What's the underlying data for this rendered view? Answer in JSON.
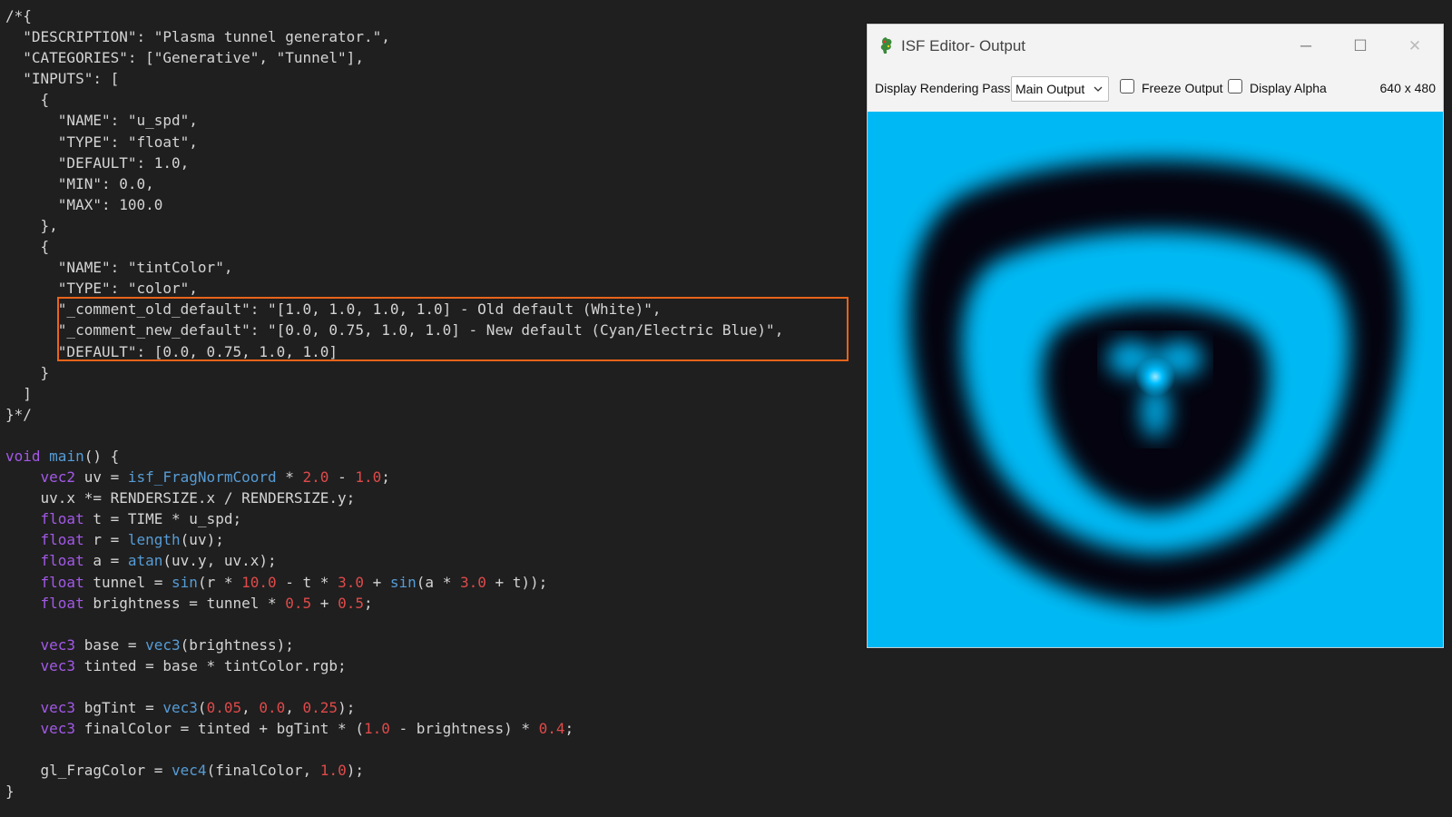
{
  "code_lines": [
    [
      {
        "t": "/*{",
        "c": ""
      }
    ],
    [
      {
        "t": "  \"DESCRIPTION\": \"Plasma tunnel generator.\",",
        "c": ""
      }
    ],
    [
      {
        "t": "  \"CATEGORIES\": [\"Generative\", \"Tunnel\"],",
        "c": ""
      }
    ],
    [
      {
        "t": "  \"INPUTS\": [",
        "c": ""
      }
    ],
    [
      {
        "t": "    {",
        "c": ""
      }
    ],
    [
      {
        "t": "      \"NAME\": \"u_spd\",",
        "c": ""
      }
    ],
    [
      {
        "t": "      \"TYPE\": \"float\",",
        "c": ""
      }
    ],
    [
      {
        "t": "      \"DEFAULT\": 1.0,",
        "c": ""
      }
    ],
    [
      {
        "t": "      \"MIN\": 0.0,",
        "c": ""
      }
    ],
    [
      {
        "t": "      \"MAX\": 100.0",
        "c": ""
      }
    ],
    [
      {
        "t": "    },",
        "c": ""
      }
    ],
    [
      {
        "t": "    {",
        "c": ""
      }
    ],
    [
      {
        "t": "      \"NAME\": \"tintColor\",",
        "c": ""
      }
    ],
    [
      {
        "t": "      \"TYPE\": \"color\",",
        "c": ""
      }
    ],
    [
      {
        "t": "      \"_comment_old_default\": \"[1.0, 1.0, 1.0, 1.0] - Old default (White)\",",
        "c": ""
      }
    ],
    [
      {
        "t": "      \"_comment_new_default\": \"[0.0, 0.75, 1.0, 1.0] - New default (Cyan/Electric Blue)\",",
        "c": ""
      }
    ],
    [
      {
        "t": "      \"DEFAULT\": [0.0, 0.75, 1.0, 1.0]",
        "c": ""
      }
    ],
    [
      {
        "t": "    }",
        "c": ""
      }
    ],
    [
      {
        "t": "  ]",
        "c": ""
      }
    ],
    [
      {
        "t": "}*/",
        "c": ""
      }
    ],
    [
      {
        "t": "",
        "c": ""
      }
    ],
    [
      {
        "t": "void",
        "c": "kw"
      },
      {
        "t": " ",
        "c": ""
      },
      {
        "t": "main",
        "c": "fn"
      },
      {
        "t": "() {",
        "c": ""
      }
    ],
    [
      {
        "t": "    ",
        "c": ""
      },
      {
        "t": "vec2",
        "c": "kw"
      },
      {
        "t": " uv = ",
        "c": ""
      },
      {
        "t": "isf_FragNormCoord",
        "c": "fn"
      },
      {
        "t": " * ",
        "c": ""
      },
      {
        "t": "2.0",
        "c": "num"
      },
      {
        "t": " - ",
        "c": ""
      },
      {
        "t": "1.0",
        "c": "num"
      },
      {
        "t": ";",
        "c": ""
      }
    ],
    [
      {
        "t": "    uv.x *= RENDERSIZE.x / RENDERSIZE.y;",
        "c": ""
      }
    ],
    [
      {
        "t": "    ",
        "c": ""
      },
      {
        "t": "float",
        "c": "kw"
      },
      {
        "t": " t = TIME * u_spd;",
        "c": ""
      }
    ],
    [
      {
        "t": "    ",
        "c": ""
      },
      {
        "t": "float",
        "c": "kw"
      },
      {
        "t": " r = ",
        "c": ""
      },
      {
        "t": "length",
        "c": "fn"
      },
      {
        "t": "(uv);",
        "c": ""
      }
    ],
    [
      {
        "t": "    ",
        "c": ""
      },
      {
        "t": "float",
        "c": "kw"
      },
      {
        "t": " a = ",
        "c": ""
      },
      {
        "t": "atan",
        "c": "fn"
      },
      {
        "t": "(uv.y, uv.x);",
        "c": ""
      }
    ],
    [
      {
        "t": "    ",
        "c": ""
      },
      {
        "t": "float",
        "c": "kw"
      },
      {
        "t": " tunnel = ",
        "c": ""
      },
      {
        "t": "sin",
        "c": "fn"
      },
      {
        "t": "(r * ",
        "c": ""
      },
      {
        "t": "10.0",
        "c": "num"
      },
      {
        "t": " - t * ",
        "c": ""
      },
      {
        "t": "3.0",
        "c": "num"
      },
      {
        "t": " + ",
        "c": ""
      },
      {
        "t": "sin",
        "c": "fn"
      },
      {
        "t": "(a * ",
        "c": ""
      },
      {
        "t": "3.0",
        "c": "num"
      },
      {
        "t": " + t));",
        "c": ""
      }
    ],
    [
      {
        "t": "    ",
        "c": ""
      },
      {
        "t": "float",
        "c": "kw"
      },
      {
        "t": " brightness = tunnel * ",
        "c": ""
      },
      {
        "t": "0.5",
        "c": "num"
      },
      {
        "t": " + ",
        "c": ""
      },
      {
        "t": "0.5",
        "c": "num"
      },
      {
        "t": ";",
        "c": ""
      }
    ],
    [
      {
        "t": "",
        "c": ""
      }
    ],
    [
      {
        "t": "    ",
        "c": ""
      },
      {
        "t": "vec3",
        "c": "kw"
      },
      {
        "t": " base = ",
        "c": ""
      },
      {
        "t": "vec3",
        "c": "fn"
      },
      {
        "t": "(brightness);",
        "c": ""
      }
    ],
    [
      {
        "t": "    ",
        "c": ""
      },
      {
        "t": "vec3",
        "c": "kw"
      },
      {
        "t": " tinted = base * tintColor.rgb;",
        "c": ""
      }
    ],
    [
      {
        "t": "",
        "c": ""
      }
    ],
    [
      {
        "t": "    ",
        "c": ""
      },
      {
        "t": "vec3",
        "c": "kw"
      },
      {
        "t": " bgTint = ",
        "c": ""
      },
      {
        "t": "vec3",
        "c": "fn"
      },
      {
        "t": "(",
        "c": ""
      },
      {
        "t": "0.05",
        "c": "num"
      },
      {
        "t": ", ",
        "c": ""
      },
      {
        "t": "0.0",
        "c": "num"
      },
      {
        "t": ", ",
        "c": ""
      },
      {
        "t": "0.25",
        "c": "num"
      },
      {
        "t": ");",
        "c": ""
      }
    ],
    [
      {
        "t": "    ",
        "c": ""
      },
      {
        "t": "vec3",
        "c": "kw"
      },
      {
        "t": " finalColor = tinted + bgTint * (",
        "c": ""
      },
      {
        "t": "1.0",
        "c": "num"
      },
      {
        "t": " - brightness) * ",
        "c": ""
      },
      {
        "t": "0.4",
        "c": "num"
      },
      {
        "t": ";",
        "c": ""
      }
    ],
    [
      {
        "t": "",
        "c": ""
      }
    ],
    [
      {
        "t": "    gl_FragColor = ",
        "c": ""
      },
      {
        "t": "vec4",
        "c": "fn"
      },
      {
        "t": "(finalColor, ",
        "c": ""
      },
      {
        "t": "1.0",
        "c": "num"
      },
      {
        "t": ");",
        "c": ""
      }
    ],
    [
      {
        "t": "}",
        "c": ""
      }
    ]
  ],
  "output_window": {
    "title": "ISF Editor- Output",
    "controls": {
      "minimize": "─",
      "maximize": "☐",
      "close": "✕"
    },
    "toolbar": {
      "pass_label": "Display Rendering Pass:",
      "pass_value": "Main Output",
      "freeze_label": "Freeze Output",
      "alpha_label": "Display Alpha",
      "resolution": "640 x 480"
    }
  },
  "colors": {
    "editor_bg": "#1f1f1f",
    "keyword": "#a259e6",
    "function": "#569cd6",
    "number": "#e04a4a",
    "highlight_border": "#e8641a",
    "tint": "#00bfff",
    "background_tint": "#0d0040"
  }
}
